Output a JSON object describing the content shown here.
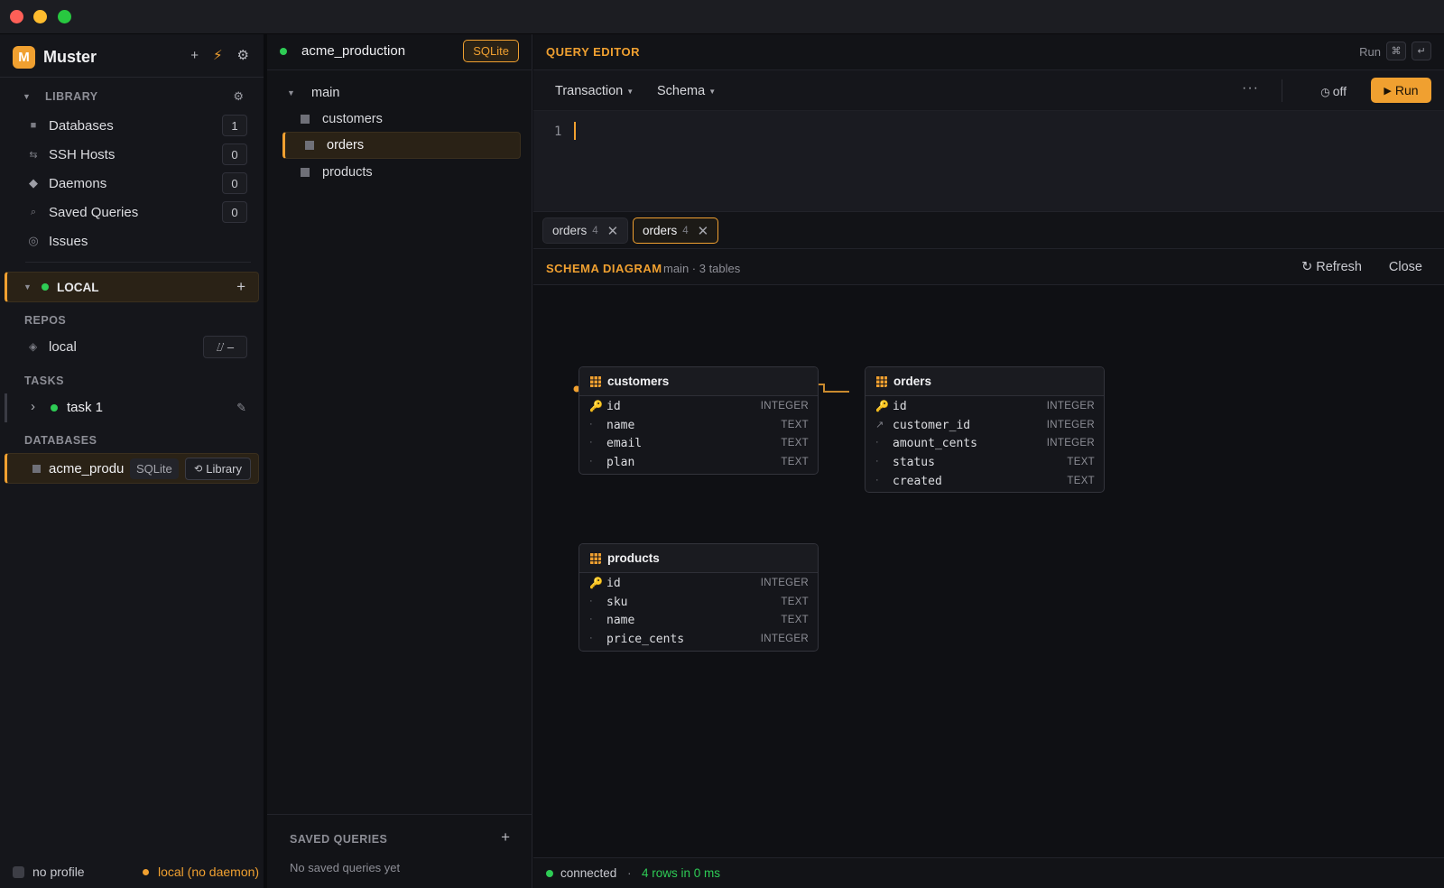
{
  "app": {
    "name": "Muster",
    "logo_letter": "M",
    "accent": "#f0a030"
  },
  "sidebar": {
    "library": {
      "title": "LIBRARY",
      "items": [
        {
          "label": "Databases",
          "count": "1",
          "icon": "database-icon"
        },
        {
          "label": "SSH Hosts",
          "count": "0",
          "icon": "ssh-icon"
        },
        {
          "label": "Daemons",
          "count": "0",
          "icon": "diamond-icon"
        },
        {
          "label": "Saved Queries",
          "count": "0",
          "icon": "search-icon"
        },
        {
          "label": "Issues",
          "icon": "circle-icon"
        }
      ]
    },
    "local": {
      "title": "LOCAL"
    },
    "repos": {
      "title": "REPOS",
      "items": [
        {
          "label": "local"
        }
      ]
    },
    "tasks": {
      "title": "TASKS",
      "items": [
        {
          "label": "task 1"
        }
      ]
    },
    "databases": {
      "title": "DATABASES",
      "items": [
        {
          "label": "acme_produ",
          "engine": "SQLite",
          "library": "Library"
        }
      ]
    },
    "footer": {
      "profile": "no profile",
      "daemon": "local (no daemon)"
    }
  },
  "middle": {
    "connection": {
      "name": "acme_production",
      "engine": "SQLite"
    },
    "schema": "main",
    "tables": [
      "customers",
      "orders",
      "products"
    ],
    "saved_queries": {
      "title": "SAVED QUERIES",
      "empty": "No saved queries yet"
    }
  },
  "query_editor": {
    "title": "QUERY EDITOR",
    "run_hint": "Run",
    "shortcut_cmd": "⌘",
    "shortcut_enter": "↵",
    "toolbar": {
      "transaction": "Transaction",
      "schema": "Schema",
      "more": "···",
      "timer": "off",
      "run": "Run"
    },
    "line_number": "1"
  },
  "tabs": [
    {
      "label": "orders",
      "count": "4"
    },
    {
      "label": "orders",
      "count": "4"
    }
  ],
  "schema_diagram": {
    "title": "SCHEMA DIAGRAM",
    "subtitle": "main · 3 tables",
    "refresh": "Refresh",
    "close": "Close",
    "tables": {
      "customers": {
        "name": "customers",
        "columns": [
          {
            "name": "id",
            "type": "INTEGER",
            "key": "pk"
          },
          {
            "name": "name",
            "type": "TEXT"
          },
          {
            "name": "email",
            "type": "TEXT"
          },
          {
            "name": "plan",
            "type": "TEXT"
          }
        ]
      },
      "orders": {
        "name": "orders",
        "columns": [
          {
            "name": "id",
            "type": "INTEGER",
            "key": "pk"
          },
          {
            "name": "customer_id",
            "type": "INTEGER",
            "key": "fk"
          },
          {
            "name": "amount_cents",
            "type": "INTEGER"
          },
          {
            "name": "status",
            "type": "TEXT"
          },
          {
            "name": "created",
            "type": "TEXT"
          }
        ]
      },
      "products": {
        "name": "products",
        "columns": [
          {
            "name": "id",
            "type": "INTEGER",
            "key": "pk"
          },
          {
            "name": "sku",
            "type": "TEXT"
          },
          {
            "name": "name",
            "type": "TEXT"
          },
          {
            "name": "price_cents",
            "type": "INTEGER"
          }
        ]
      }
    }
  },
  "status_bar": {
    "state": "connected",
    "separator": "·",
    "result": "4 rows in 0 ms"
  }
}
